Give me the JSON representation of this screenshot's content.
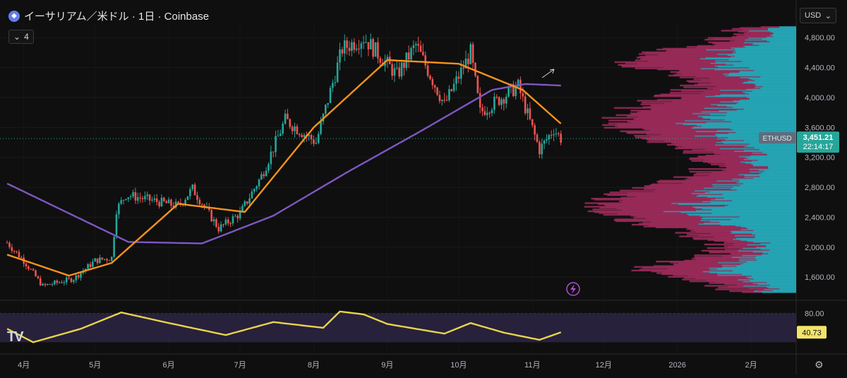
{
  "header": {
    "symbol_text": "イーサリアム／米ドル · 1日 · Coinbase",
    "indicator_count": "4",
    "currency": "USD",
    "logo": "TV"
  },
  "price_axis": {
    "labels": [
      "4,800.00",
      "4,400.00",
      "4,000.00",
      "3,600.00",
      "3,200.00",
      "2,800.00",
      "2,400.00",
      "2,000.00",
      "1,600.00"
    ],
    "ticks": [
      4800,
      4400,
      4000,
      3600,
      3200,
      2800,
      2400,
      2000,
      1600
    ]
  },
  "time_axis": {
    "labels": [
      "4月",
      "5月",
      "6月",
      "7月",
      "8月",
      "9月",
      "10月",
      "11月",
      "12月",
      "2026",
      "2月"
    ]
  },
  "last_price": {
    "symbol": "ETHUSD",
    "price": "3,451.21",
    "countdown": "22:14:17",
    "value": 3451.21,
    "color": "#26a69a"
  },
  "oscillator": {
    "upper_label": "80.00",
    "current_label": "40.73",
    "current_value": 40.73,
    "upper": 80,
    "lower": 20,
    "line_color": "#e8d44d",
    "band_color": "#2a2440"
  },
  "colors": {
    "up": "#26a69a",
    "down": "#ef5350",
    "ma_fast": "#f7931a",
    "ma_slow": "#7e57c2",
    "vp_up": "#26a6b7",
    "vp_down": "#9c2c5a"
  },
  "chart_data": {
    "type": "candlestick",
    "ohlc_anchor_closes": [
      {
        "date": "2025-03-25",
        "close": 2060
      },
      {
        "date": "2025-04-01",
        "close": 1820
      },
      {
        "date": "2025-04-09",
        "close": 1480
      },
      {
        "date": "2025-04-22",
        "close": 1580
      },
      {
        "date": "2025-05-01",
        "close": 1820
      },
      {
        "date": "2025-05-08",
        "close": 1860
      },
      {
        "date": "2025-05-10",
        "close": 2500
      },
      {
        "date": "2025-05-14",
        "close": 2700
      },
      {
        "date": "2025-06-05",
        "close": 2550
      },
      {
        "date": "2025-06-11",
        "close": 2780
      },
      {
        "date": "2025-06-22",
        "close": 2250
      },
      {
        "date": "2025-07-01",
        "close": 2450
      },
      {
        "date": "2025-07-10",
        "close": 2950
      },
      {
        "date": "2025-07-20",
        "close": 3700
      },
      {
        "date": "2025-08-02",
        "close": 3400
      },
      {
        "date": "2025-08-13",
        "close": 4650
      },
      {
        "date": "2025-08-22",
        "close": 4800
      },
      {
        "date": "2025-09-05",
        "close": 4300
      },
      {
        "date": "2025-09-13",
        "close": 4700
      },
      {
        "date": "2025-09-25",
        "close": 3900
      },
      {
        "date": "2025-10-06",
        "close": 4600
      },
      {
        "date": "2025-10-10",
        "close": 3800
      },
      {
        "date": "2025-10-26",
        "close": 4150
      },
      {
        "date": "2025-11-04",
        "close": 3300
      },
      {
        "date": "2025-11-10",
        "close": 3580
      },
      {
        "date": "2025-11-13",
        "close": 3451
      }
    ],
    "ma_fast_anchors": [
      {
        "date": "2025-03-25",
        "value": 1900
      },
      {
        "date": "2025-04-20",
        "value": 1620
      },
      {
        "date": "2025-05-08",
        "value": 1790
      },
      {
        "date": "2025-06-05",
        "value": 2580
      },
      {
        "date": "2025-07-03",
        "value": 2470
      },
      {
        "date": "2025-08-01",
        "value": 3600
      },
      {
        "date": "2025-09-01",
        "value": 4500
      },
      {
        "date": "2025-10-01",
        "value": 4450
      },
      {
        "date": "2025-10-28",
        "value": 4100
      },
      {
        "date": "2025-11-13",
        "value": 3650
      }
    ],
    "ma_slow_anchors": [
      {
        "date": "2025-03-25",
        "value": 2850
      },
      {
        "date": "2025-05-15",
        "value": 2070
      },
      {
        "date": "2025-06-15",
        "value": 2050
      },
      {
        "date": "2025-07-15",
        "value": 2420
      },
      {
        "date": "2025-08-15",
        "value": 3000
      },
      {
        "date": "2025-09-15",
        "value": 3550
      },
      {
        "date": "2025-10-15",
        "value": 4100
      },
      {
        "date": "2025-10-29",
        "value": 4180
      },
      {
        "date": "2025-11-13",
        "value": 4160
      }
    ],
    "oscillator_anchors": [
      {
        "date": "2025-03-25",
        "value": 48
      },
      {
        "date": "2025-04-05",
        "value": 20
      },
      {
        "date": "2025-04-25",
        "value": 48
      },
      {
        "date": "2025-05-12",
        "value": 82
      },
      {
        "date": "2025-06-01",
        "value": 60
      },
      {
        "date": "2025-06-25",
        "value": 35
      },
      {
        "date": "2025-07-15",
        "value": 62
      },
      {
        "date": "2025-08-05",
        "value": 50
      },
      {
        "date": "2025-08-12",
        "value": 84
      },
      {
        "date": "2025-08-22",
        "value": 78
      },
      {
        "date": "2025-09-01",
        "value": 58
      },
      {
        "date": "2025-09-25",
        "value": 38
      },
      {
        "date": "2025-10-06",
        "value": 60
      },
      {
        "date": "2025-10-20",
        "value": 40
      },
      {
        "date": "2025-11-04",
        "value": 25
      },
      {
        "date": "2025-11-13",
        "value": 40.73
      }
    ],
    "ylim": [
      1300,
      5000
    ],
    "xlim": [
      "2025-03-22",
      "2026-02-20"
    ]
  }
}
